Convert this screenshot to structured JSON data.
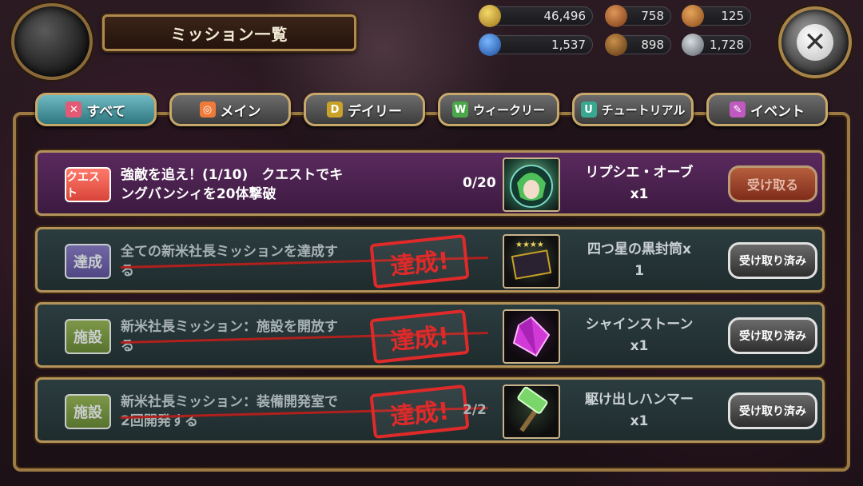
{
  "header": {
    "title": "ミッション一覧"
  },
  "resources": [
    {
      "icon": "gold-coin-icon",
      "value": "46,496",
      "color": "#c9a227"
    },
    {
      "icon": "meat-icon",
      "value": "758",
      "color": "#b0632c"
    },
    {
      "icon": "bread-icon",
      "value": "125",
      "color": "#c07a3a"
    },
    {
      "icon": "blue-gem-icon",
      "value": "1,537",
      "color": "#3a7bd0"
    },
    {
      "icon": "wood-icon",
      "value": "898",
      "color": "#8a5a2a"
    },
    {
      "icon": "iron-ingot-icon",
      "value": "1,728",
      "color": "#9aa0a8"
    }
  ],
  "tabs": [
    {
      "label": "すべて",
      "icon": "all-icon",
      "icon_text": "✕",
      "icon_color": "#e35a74",
      "active": true
    },
    {
      "label": "メイン",
      "icon": "main-icon",
      "icon_text": "◎",
      "icon_color": "#ef7a3a",
      "active": false
    },
    {
      "label": "デイリー",
      "icon": "daily-icon",
      "icon_text": "D",
      "icon_color": "#c9a227",
      "active": false
    },
    {
      "label": "ウィークリー",
      "icon": "weekly-icon",
      "icon_text": "W",
      "icon_color": "#4aa84a",
      "active": false
    },
    {
      "label": "チュートリアル",
      "icon": "tutorial-icon",
      "icon_text": "U",
      "icon_color": "#3aa890",
      "active": false
    },
    {
      "label": "イベント",
      "icon": "event-icon",
      "icon_text": "✎",
      "icon_color": "#c05ac0",
      "active": false
    }
  ],
  "missions": [
    {
      "badge": "クエスト",
      "description_line1": "強敵を追え！(1/10)　クエストでキ",
      "description_line2": "ングバンシィを20体撃破",
      "progress": "0/20",
      "reward_name": "リプシエ・オーブ",
      "reward_qty": "x1",
      "button": "受け取る",
      "status": "ready"
    },
    {
      "badge": "達成",
      "description_line1": "全ての新米社長ミッションを達成す",
      "description_line2": "る",
      "progress": "",
      "reward_name": "四つ星の黒封筒x",
      "reward_qty": "1",
      "button": "受け取り済み",
      "status": "claimed",
      "stamp": "達成!"
    },
    {
      "badge": "施設",
      "description_line1": "新米社長ミッション：施設を開放す",
      "description_line2": "る",
      "progress": "",
      "reward_name": "シャインストーン",
      "reward_qty": "x1",
      "button": "受け取り済み",
      "status": "claimed",
      "stamp": "達成!"
    },
    {
      "badge": "施設",
      "description_line1": "新米社長ミッション：装備開発室で",
      "description_line2": "2回開発する",
      "progress": "2/2",
      "reward_name": "駆け出しハンマー",
      "reward_qty": "x1",
      "button": "受け取り済み",
      "status": "claimed",
      "stamp": "達成!"
    }
  ]
}
